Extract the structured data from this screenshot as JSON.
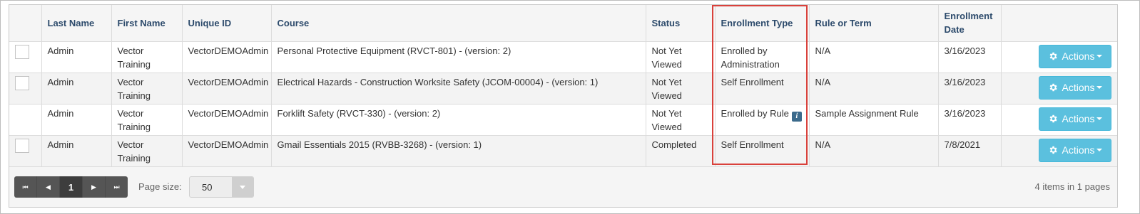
{
  "columns": {
    "last_name": "Last Name",
    "first_name": "First Name",
    "unique_id": "Unique ID",
    "course": "Course",
    "status": "Status",
    "enrollment_type": "Enrollment Type",
    "rule_or_term": "Rule or Term",
    "enrollment_date": "Enrollment Date"
  },
  "rows": [
    {
      "has_checkbox": true,
      "last_name": "Admin",
      "first_name": "Vector Training",
      "unique_id": "VectorDEMOAdmin",
      "course": "Personal Protective Equipment (RVCT-801) - (version: 2)",
      "status": "Not Yet Viewed",
      "enrollment_type": "Enrolled by Administration",
      "rule_or_term": "N/A",
      "enrollment_date": "3/16/2023",
      "actions_label": "Actions"
    },
    {
      "has_checkbox": true,
      "last_name": "Admin",
      "first_name": "Vector Training",
      "unique_id": "VectorDEMOAdmin",
      "course": "Electrical Hazards - Construction Worksite Safety (JCOM-00004) - (version: 1)",
      "status": "Not Yet Viewed",
      "enrollment_type": "Self Enrollment",
      "rule_or_term": "N/A",
      "enrollment_date": "3/16/2023",
      "actions_label": "Actions"
    },
    {
      "has_checkbox": false,
      "has_info_icon": true,
      "info_icon_glyph": "i",
      "last_name": "Admin",
      "first_name": "Vector Training",
      "unique_id": "VectorDEMOAdmin",
      "course": "Forklift Safety (RVCT-330) - (version: 2)",
      "status": "Not Yet Viewed",
      "enrollment_type": "Enrolled by Rule",
      "rule_or_term": "Sample Assignment Rule",
      "enrollment_date": "3/16/2023",
      "actions_label": "Actions"
    },
    {
      "has_checkbox": true,
      "last_name": "Admin",
      "first_name": "Vector Training",
      "unique_id": "VectorDEMOAdmin",
      "course": "Gmail Essentials 2015 (RVBB-3268) - (version: 1)",
      "status": "Completed",
      "enrollment_type": "Self Enrollment",
      "rule_or_term": "N/A",
      "enrollment_date": "7/8/2021",
      "actions_label": "Actions"
    }
  ],
  "pager": {
    "first_glyph": "⏮",
    "prev_glyph": "◀",
    "current_page": "1",
    "next_glyph": "▶",
    "last_glyph": "⏭",
    "page_size_label": "Page size:",
    "page_size_value": "50",
    "summary": "4 items in 1 pages"
  },
  "icons": {
    "actions": "gear-icon",
    "actions_caret": "caret-down-icon",
    "rule_info": "info-icon",
    "page_size_dropdown": "chevron-down-icon"
  },
  "colors": {
    "actions_button": "#5bc0de",
    "header_text": "#2c4a6b",
    "highlight_border": "#d9413b",
    "info_icon": "#3c6b8c",
    "pager_background": "#555555"
  }
}
